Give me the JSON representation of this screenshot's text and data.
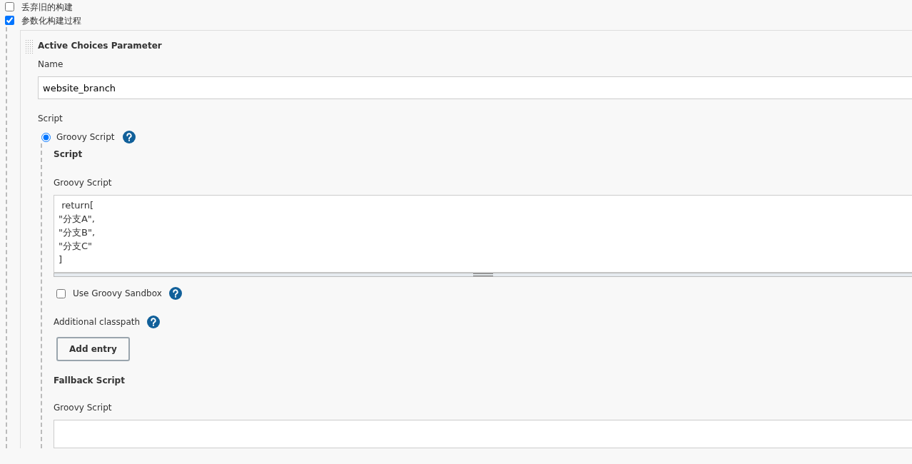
{
  "options": [
    {
      "label": "丢弃旧的构建",
      "checked": false
    },
    {
      "label": "参数化构建过程",
      "checked": true
    }
  ],
  "parameter": {
    "title": "Active Choices Parameter",
    "name_label": "Name",
    "name_value": "website_branch",
    "script_label": "Script",
    "script_types": [
      {
        "label": "Groovy Script",
        "selected": true
      }
    ],
    "script_section": {
      "title": "Script",
      "groovy_label": "Groovy Script",
      "code": " return[\n\"分支A\",\n\"分支B\",\n\"分支C\"\n]"
    },
    "sandbox": {
      "label": "Use Groovy Sandbox",
      "checked": false
    },
    "classpath": {
      "label": "Additional classpath",
      "button": "Add entry"
    },
    "fallback": {
      "title": "Fallback Script",
      "groovy_label": "Groovy Script"
    }
  }
}
